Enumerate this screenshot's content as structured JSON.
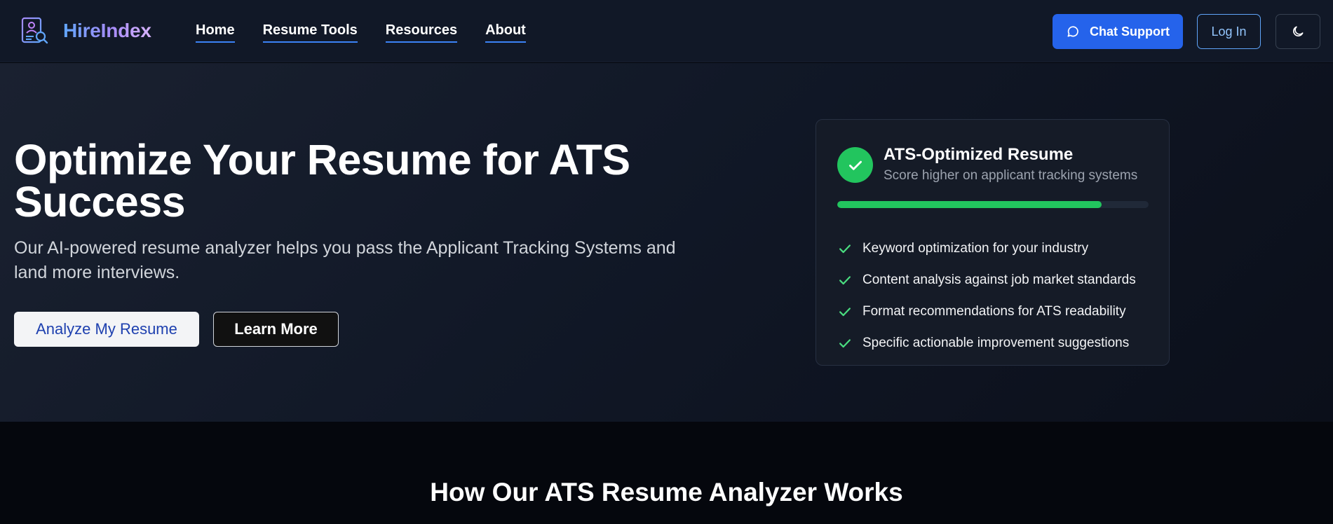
{
  "nav": {
    "brand": "HireIndex",
    "links": [
      "Home",
      "Resume Tools",
      "Resources",
      "About"
    ],
    "chat_label": "Chat Support",
    "login_label": "Log In"
  },
  "hero": {
    "title": "Optimize Your Resume for ATS Success",
    "subtitle": "Our AI-powered resume analyzer helps you pass the Applicant Tracking Systems and land more interviews.",
    "primary_button": "Analyze My Resume",
    "secondary_button": "Learn More"
  },
  "card": {
    "title": "ATS-Optimized Resume",
    "subtitle": "Score higher on applicant tracking systems",
    "progress_percent": 85,
    "features": [
      "Keyword optimization for your industry",
      "Content analysis against job market standards",
      "Format recommendations for ATS readability",
      "Specific actionable improvement suggestions"
    ]
  },
  "section": {
    "title": "How Our ATS Resume Analyzer Works"
  },
  "colors": {
    "accent": "#2563eb",
    "success": "#22c55e",
    "nav_bg": "#111827"
  },
  "icons": [
    "logo-icon",
    "chat-icon",
    "moon-icon",
    "check-circle-icon",
    "check-icon"
  ]
}
